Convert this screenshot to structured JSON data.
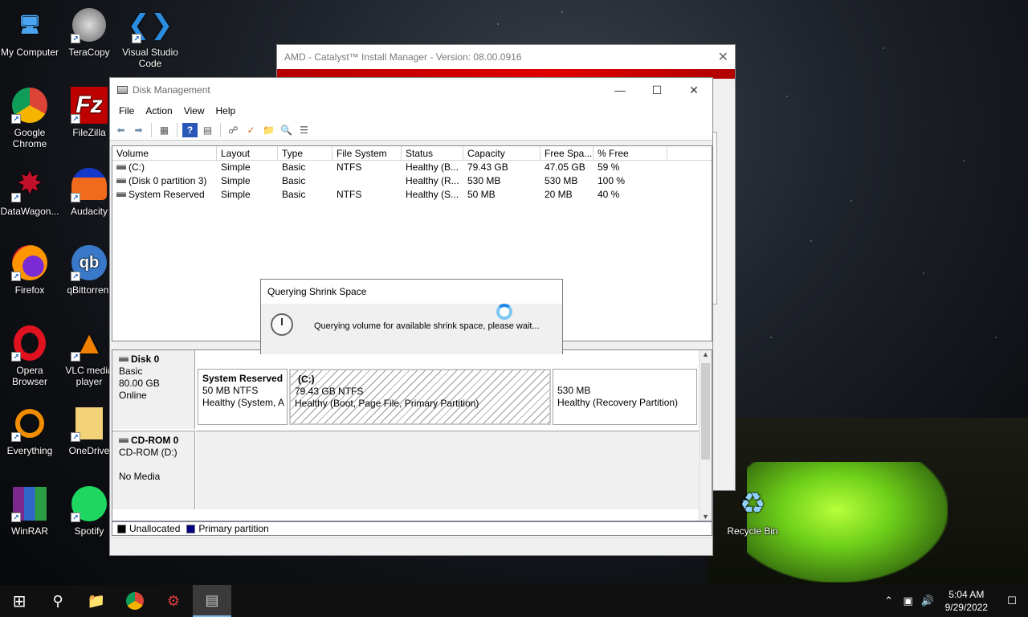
{
  "desktop": {
    "icons": [
      {
        "label": "My Computer"
      },
      {
        "label": "TeraCopy"
      },
      {
        "label": "Visual Studio Code"
      },
      {
        "label": "Google Chrome"
      },
      {
        "label": "FileZilla"
      },
      {
        "label": "DataWagon..."
      },
      {
        "label": "Audacity"
      },
      {
        "label": "Firefox"
      },
      {
        "label": "qBittorrent"
      },
      {
        "label": "Opera Browser"
      },
      {
        "label": "VLC media player"
      },
      {
        "label": "Everything"
      },
      {
        "label": "OneDrive"
      },
      {
        "label": "WinRAR"
      },
      {
        "label": "Spotify"
      },
      {
        "label": "Recycle Bin"
      }
    ]
  },
  "amd_window": {
    "title": "AMD - Catalyst™ Install Manager - Version: 08.00.0916",
    "close_glyph": "✕"
  },
  "disk_mgmt": {
    "title": "Disk Management",
    "buttons": {
      "minimize": "—",
      "maximize": "☐",
      "close": "✕"
    },
    "menu": [
      "File",
      "Action",
      "View",
      "Help"
    ],
    "columns": [
      "Volume",
      "Layout",
      "Type",
      "File System",
      "Status",
      "Capacity",
      "Free Spa...",
      "% Free"
    ],
    "rows": [
      {
        "volume": "(C:)",
        "layout": "Simple",
        "type": "Basic",
        "fs": "NTFS",
        "status": "Healthy (B...",
        "capacity": "79.43 GB",
        "free": "47.05 GB",
        "pct": "59 %"
      },
      {
        "volume": "(Disk 0 partition 3)",
        "layout": "Simple",
        "type": "Basic",
        "fs": "",
        "status": "Healthy (R...",
        "capacity": "530 MB",
        "free": "530 MB",
        "pct": "100 %"
      },
      {
        "volume": "System Reserved",
        "layout": "Simple",
        "type": "Basic",
        "fs": "NTFS",
        "status": "Healthy (S...",
        "capacity": "50 MB",
        "free": "20 MB",
        "pct": "40 %"
      }
    ],
    "disk0": {
      "name": "Disk 0",
      "type": "Basic",
      "size": "80.00 GB",
      "state": "Online",
      "partitions": [
        {
          "name": "System Reserved",
          "detail": "50 MB NTFS",
          "status": "Healthy (System, A"
        },
        {
          "name": "(C:)",
          "detail": "79.43 GB NTFS",
          "status": "Healthy (Boot, Page File, Primary Partition)"
        },
        {
          "name": "",
          "detail": "530 MB",
          "status": "Healthy (Recovery Partition)"
        }
      ]
    },
    "cdrom0": {
      "name": "CD-ROM 0",
      "drive": "CD-ROM (D:)",
      "media": "No Media"
    },
    "legend": {
      "unallocated": "Unallocated",
      "primary": "Primary partition"
    },
    "colors": {
      "primary": "#000080",
      "unallocated": "#000000"
    }
  },
  "dialog": {
    "title": "Querying Shrink Space",
    "message": "Querying volume for available shrink space, please wait..."
  },
  "taskbar": {
    "time": "5:04 AM",
    "date": "9/29/2022"
  }
}
